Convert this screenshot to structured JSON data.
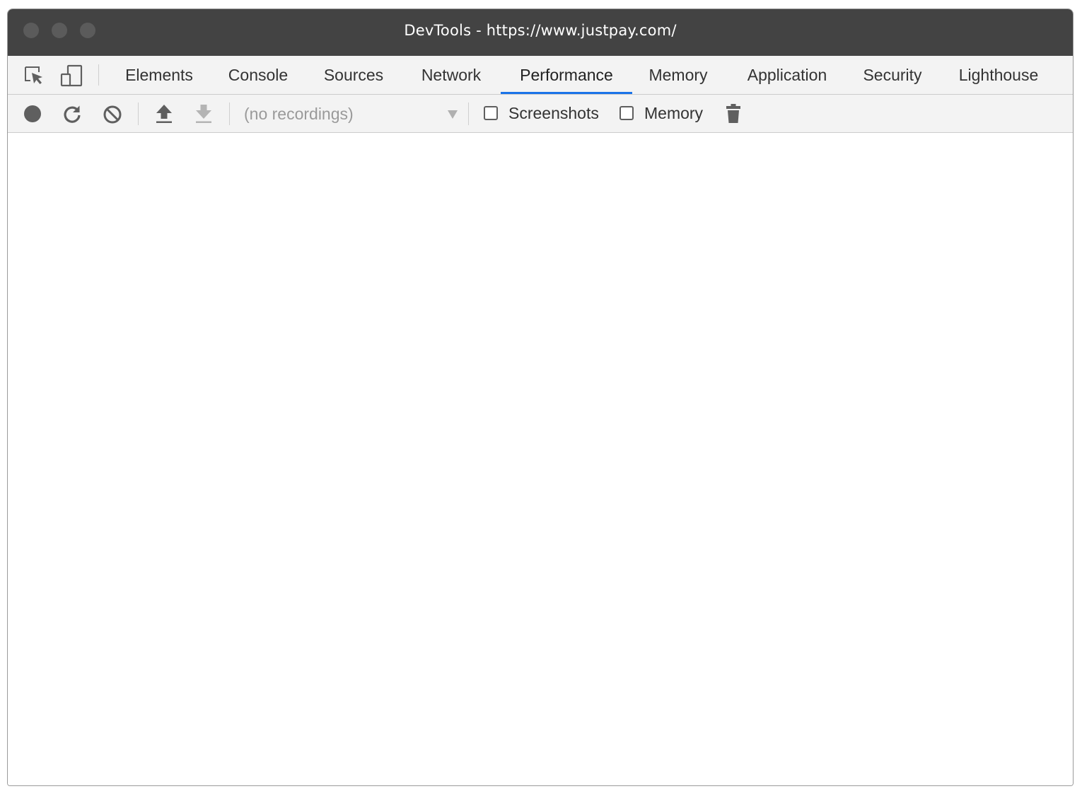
{
  "window": {
    "title": "DevTools - https://www.justpay.com/",
    "traffic_lights": [
      "close",
      "minimize",
      "zoom"
    ]
  },
  "tabbar": {
    "left_icons": [
      "inspect-element-icon",
      "device-toolbar-icon"
    ],
    "tabs": [
      {
        "label": "Elements",
        "active": false
      },
      {
        "label": "Console",
        "active": false
      },
      {
        "label": "Sources",
        "active": false
      },
      {
        "label": "Network",
        "active": false
      },
      {
        "label": "Performance",
        "active": true
      },
      {
        "label": "Memory",
        "active": false
      },
      {
        "label": "Application",
        "active": false
      },
      {
        "label": "Security",
        "active": false
      },
      {
        "label": "Lighthouse",
        "active": false
      }
    ],
    "active_color": "#1a73e8"
  },
  "toolbar": {
    "icons": [
      "record-icon",
      "reload-record-icon",
      "clear-icon",
      "upload-icon",
      "download-icon",
      "trash-icon"
    ],
    "recordings_select": "(no recordings)",
    "checkboxes": [
      {
        "label": "Screenshots",
        "checked": false
      },
      {
        "label": "Memory",
        "checked": false
      }
    ]
  },
  "colors": {
    "titlebar": "#434343",
    "toolbar_bg": "#f3f3f3",
    "accent": "#1a73e8"
  }
}
